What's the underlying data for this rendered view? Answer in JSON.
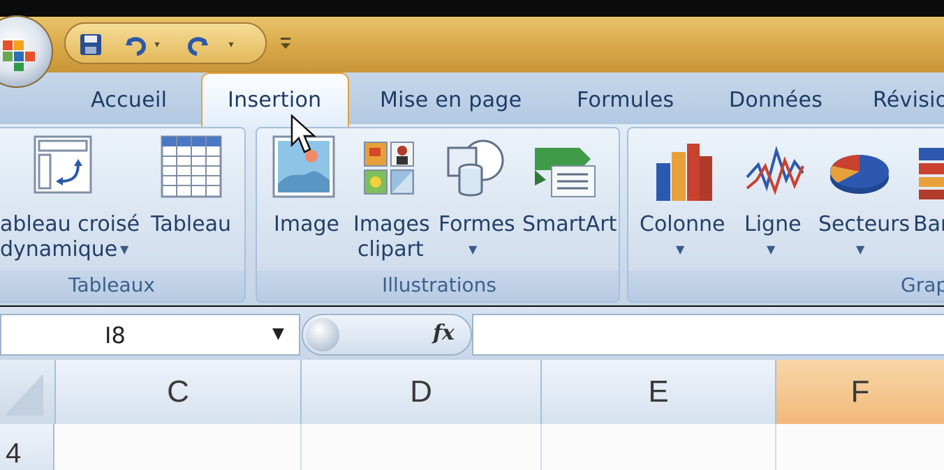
{
  "qat": {
    "save_icon": "save-icon",
    "undo_icon": "undo-icon",
    "redo_icon": "redo-icon",
    "customize_icon": "customize-icon"
  },
  "tabs": [
    {
      "label": "Accueil"
    },
    {
      "label": "Insertion",
      "active": true
    },
    {
      "label": "Mise en page"
    },
    {
      "label": "Formules"
    },
    {
      "label": "Données"
    },
    {
      "label": "Révisio"
    }
  ],
  "ribbon": {
    "groups": [
      {
        "label": "Tableaux",
        "buttons": [
          {
            "label_line1": "ableau croisé",
            "label_line2": "dynamique",
            "has_dropdown": true,
            "icon": "pivot-table-icon"
          },
          {
            "label_line1": "Tableau",
            "icon": "table-icon"
          }
        ]
      },
      {
        "label": "Illustrations",
        "buttons": [
          {
            "label_line1": "Image",
            "icon": "image-icon"
          },
          {
            "label_line1": "Images",
            "label_line2": "clipart",
            "icon": "clipart-icon"
          },
          {
            "label_line1": "Formes",
            "has_dropdown": true,
            "icon": "shapes-icon"
          },
          {
            "label_line1": "SmartArt",
            "icon": "smartart-icon"
          }
        ]
      },
      {
        "label": "Grap",
        "buttons": [
          {
            "label_line1": "Colonne",
            "has_dropdown": true,
            "icon": "column-chart-icon"
          },
          {
            "label_line1": "Ligne",
            "has_dropdown": true,
            "icon": "line-chart-icon"
          },
          {
            "label_line1": "Secteurs",
            "has_dropdown": true,
            "icon": "pie-chart-icon"
          },
          {
            "label_line1": "Bar",
            "icon": "bar-chart-icon"
          }
        ]
      }
    ]
  },
  "formula_bar": {
    "name_box": "I8",
    "fx": "fx",
    "formula": ""
  },
  "grid": {
    "columns": [
      "C",
      "D",
      "E",
      "F"
    ],
    "selected_column": "F",
    "rows": [
      "4"
    ]
  },
  "colors": {
    "title_bar": "#d6a544",
    "ribbon": "#cddbec",
    "tab_text": "#1f3b66",
    "active_tab_border": "#e3a23a",
    "selected_col": "#f2b97a"
  }
}
